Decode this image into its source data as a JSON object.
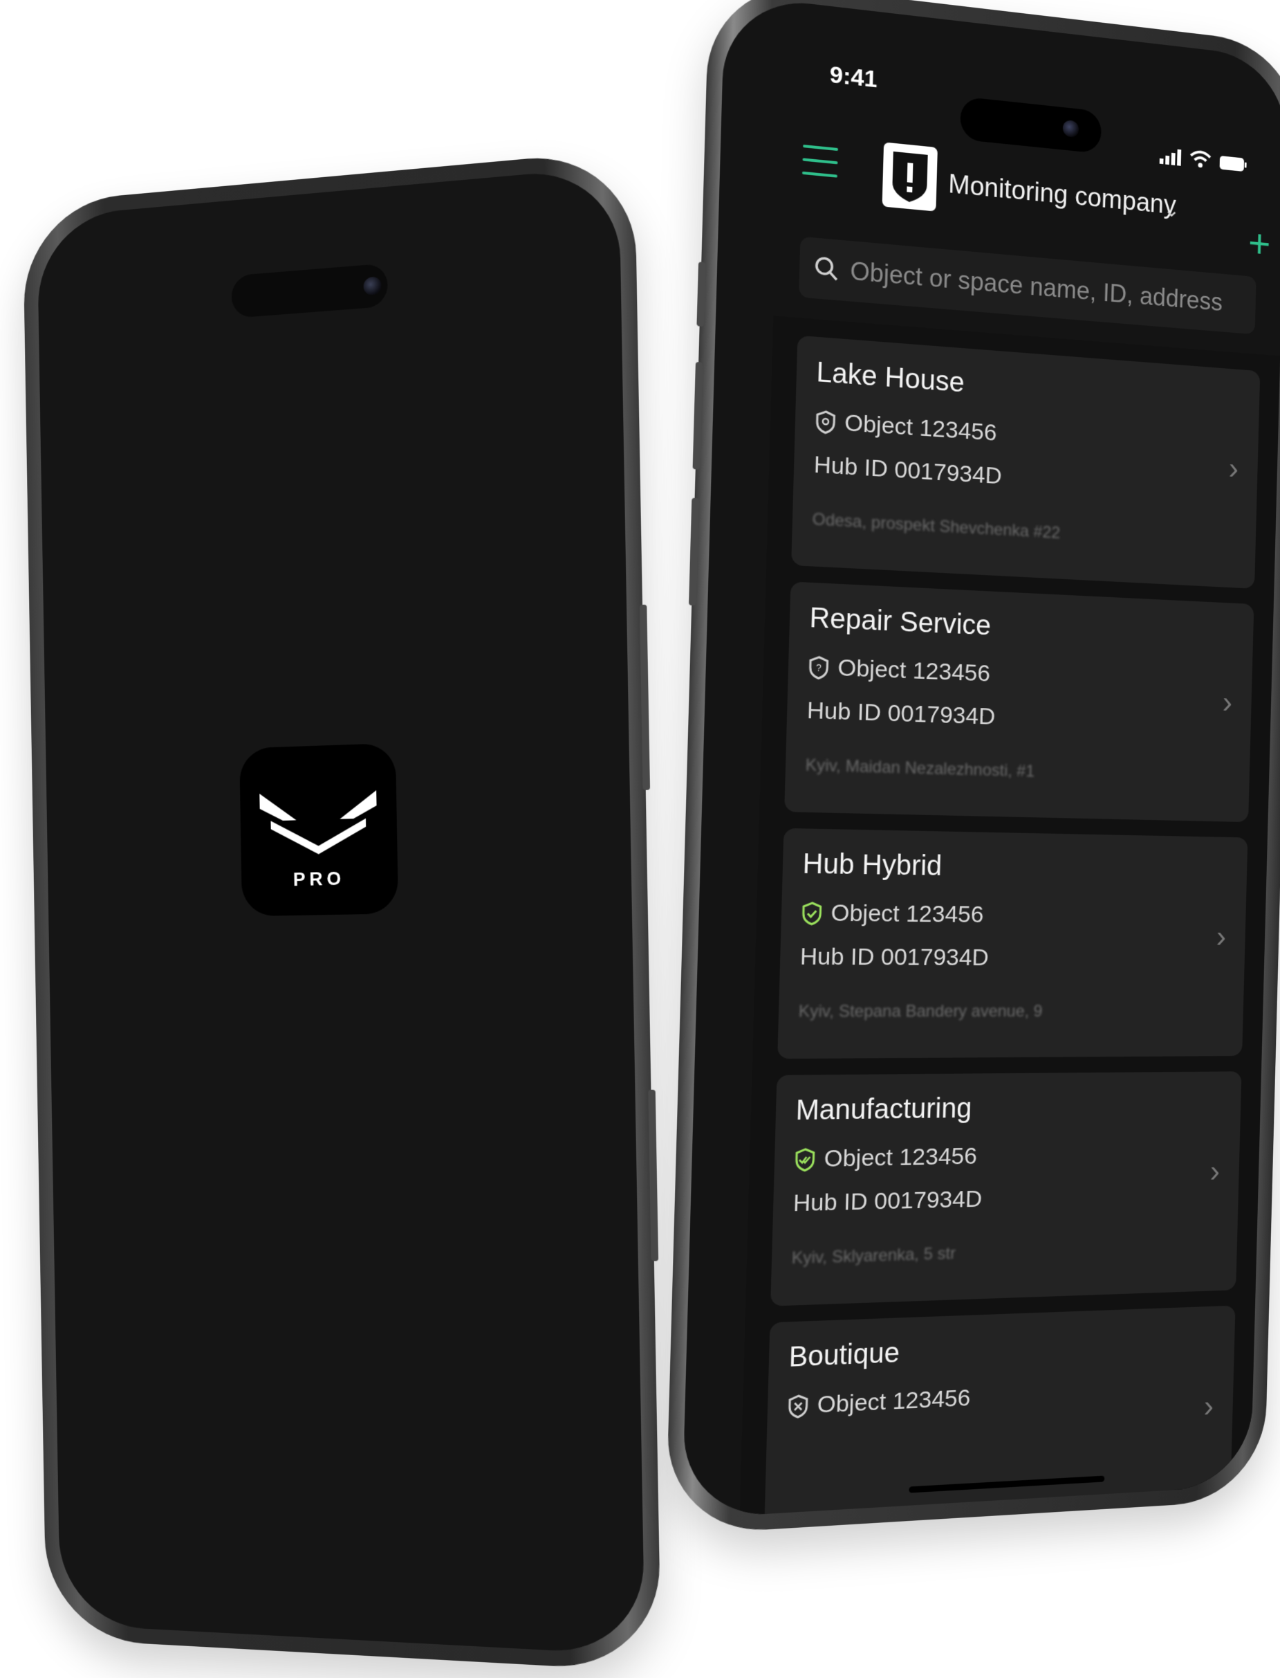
{
  "splash": {
    "app_badge_text": "PRO"
  },
  "status_bar": {
    "time": "9:41"
  },
  "header": {
    "company_name": "Monitoring company",
    "menu_icon": "hamburger-menu-icon",
    "add_icon": "plus-icon",
    "dropdown_icon": "chevron-down-icon",
    "logo_icon": "shield-exclamation-icon"
  },
  "search": {
    "placeholder": "Object or space name, ID, address"
  },
  "colors": {
    "accent": "#2fbf8b",
    "card_bg": "#232323",
    "screen_bg": "#141414",
    "armed_green": "#9be15d"
  },
  "objects": [
    {
      "name": "Lake House",
      "object": "Object 123456",
      "hub": "Hub ID 0017934D",
      "address": "Odesa, prospekt Shevchenka #22",
      "status_icon": "shield-disarmed-icon",
      "status_color": "#cfcfcf"
    },
    {
      "name": "Repair Service",
      "object": "Object 123456",
      "hub": "Hub ID 0017934D",
      "address": "Kyiv, Maidan Nezalezhnosti, #1",
      "status_icon": "shield-question-icon",
      "status_color": "#cfcfcf"
    },
    {
      "name": "Hub Hybrid",
      "object": "Object 123456",
      "hub": "Hub ID 0017934D",
      "address": "Kyiv, Stepana Bandery avenue, 9",
      "status_icon": "shield-check-icon",
      "status_color": "#9be15d"
    },
    {
      "name": "Manufacturing",
      "object": "Object 123456",
      "hub": "Hub ID 0017934D",
      "address": "Kyiv, Sklyarenka, 5 str",
      "status_icon": "shield-double-check-icon",
      "status_color": "#9be15d"
    },
    {
      "name": "Boutique",
      "object": "Object 123456",
      "hub": "",
      "address": "",
      "status_icon": "shield-x-icon",
      "status_color": "#cfcfcf"
    }
  ]
}
